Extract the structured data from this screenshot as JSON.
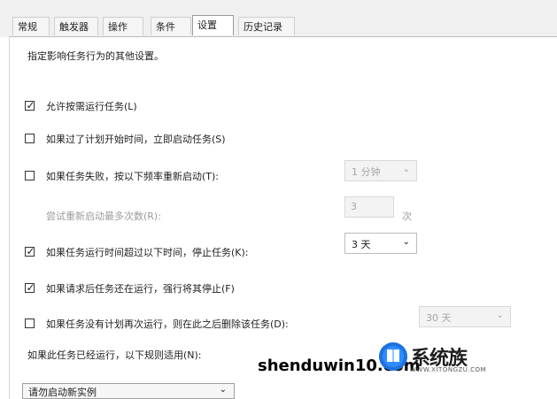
{
  "tabs": [
    "常规",
    "触发器",
    "操作",
    "条件",
    "设置",
    "历史记录"
  ],
  "active_tab": "设置",
  "description": "指定影响任务行为的其他设置。",
  "options": {
    "allow_on_demand": {
      "label": "允许按需运行任务(L)",
      "checked": true
    },
    "start_asap": {
      "label": "如果过了计划开始时间，立即启动任务(S)",
      "checked": false
    },
    "restart_on_fail": {
      "label": "如果任务失败，按以下频率重新启动(T):",
      "checked": false,
      "interval": "1 分钟"
    },
    "restart_attempts": {
      "label": "尝试重新启动最多次数(R):",
      "value": "3",
      "unit": "次"
    },
    "stop_if_runs_longer": {
      "label": "如果任务运行时间超过以下时间，停止任务(K):",
      "checked": true,
      "value": "3 天"
    },
    "force_stop": {
      "label": "如果请求后任务还在运行，强行将其停止(F)",
      "checked": true
    },
    "delete_if_not_scheduled": {
      "label": "如果任务没有计划再次运行，则在此之后删除该任务(D):",
      "checked": false,
      "value": "30 天"
    },
    "rule_label": "如果此任务已经运行，以下规则适用(N):",
    "rule_value": "请勿启动新实例"
  },
  "watermark": {
    "site": "shenduwin10.com",
    "brand": "系统族",
    "sub": "WWW.XITONGZU.COM"
  }
}
